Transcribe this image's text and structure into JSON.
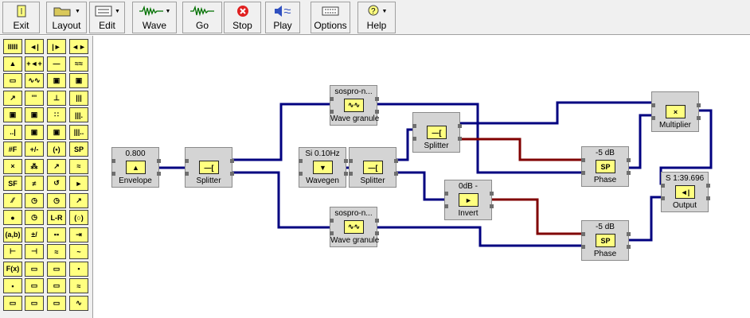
{
  "toolbar": {
    "buttons": [
      {
        "id": "exit",
        "label": "Exit",
        "icon": "exit-icon",
        "dropdown": false
      },
      {
        "id": "layout",
        "label": "Layout",
        "icon": "folder-icon",
        "dropdown": true
      },
      {
        "id": "edit",
        "label": "Edit",
        "icon": "document-icon",
        "dropdown": true
      },
      {
        "id": "wave",
        "label": "Wave",
        "icon": "waveform-icon",
        "dropdown": true
      },
      {
        "id": "go",
        "label": "Go",
        "icon": "waveform-icon",
        "dropdown": false
      },
      {
        "id": "stop",
        "label": "Stop",
        "icon": "stop-icon",
        "dropdown": false
      },
      {
        "id": "play",
        "label": "Play",
        "icon": "speaker-icon",
        "dropdown": false
      },
      {
        "id": "options",
        "label": "Options",
        "icon": "keyboard-icon",
        "dropdown": false
      },
      {
        "id": "help",
        "label": "Help",
        "icon": "help-icon",
        "dropdown": true
      }
    ]
  },
  "palette": {
    "items": [
      "IIIII",
      "◄|",
      "|►",
      "◄►",
      "▲",
      "+◄+",
      "—",
      "≈≈",
      "▭",
      "∿∿",
      "▣",
      "▣",
      "↗",
      "'''",
      "⊥",
      "|||",
      "▣",
      "▣",
      "∷",
      "|||.",
      "..|",
      "▣",
      "▣",
      "|||..",
      "#F",
      "+/-",
      "(•)",
      "SP",
      "×",
      "⁂",
      "↗",
      "≈",
      "SF",
      "≠",
      "↺",
      "►",
      "⁄⁄",
      "◷",
      "◷",
      "↗",
      "●",
      "◷",
      "L-R",
      "(○)",
      "(a,b)",
      "±/",
      "▪▪",
      "⇥",
      "⊢",
      "⊣",
      "≈",
      "~",
      "F(x)",
      "▭",
      "▭",
      "▪",
      "▪",
      "▭",
      "▭",
      "≈",
      "▭",
      "▭",
      "▭",
      "∿"
    ]
  },
  "modules": [
    {
      "id": "envelope",
      "top": "0.800",
      "bottom": "Envelope",
      "icon": "▲"
    },
    {
      "id": "splitter1",
      "top": "",
      "bottom": "Splitter",
      "icon": "—["
    },
    {
      "id": "wavegran1",
      "top": "sospro-n...",
      "bottom": "Wave granule",
      "icon": "∿∿"
    },
    {
      "id": "wavegran2",
      "top": "sospro-n...",
      "bottom": "Wave granule",
      "icon": "∿∿"
    },
    {
      "id": "wavegen",
      "top": "Si 0.10Hz",
      "bottom": "Wavegen",
      "icon": "▼"
    },
    {
      "id": "splitter2",
      "top": "",
      "bottom": "Splitter",
      "icon": "—["
    },
    {
      "id": "splitter3",
      "top": "",
      "bottom": "Splitter",
      "icon": "—["
    },
    {
      "id": "invert",
      "top": "0dB -",
      "bottom": "Invert",
      "icon": "►"
    },
    {
      "id": "phase1",
      "top": "-5 dB",
      "bottom": "Phase",
      "icon": "SP"
    },
    {
      "id": "phase2",
      "top": "-5 dB",
      "bottom": "Phase",
      "icon": "SP"
    },
    {
      "id": "multiplier",
      "top": "",
      "bottom": "Multiplier",
      "icon": "×"
    },
    {
      "id": "output",
      "top": "S 1:39.696",
      "bottom": "Output",
      "icon": "◄|"
    }
  ],
  "colors": {
    "wire_blue": "#000080",
    "wire_red": "#800000",
    "icon_yellow": "#ffff80",
    "module_gray": "#d4d4d4"
  }
}
